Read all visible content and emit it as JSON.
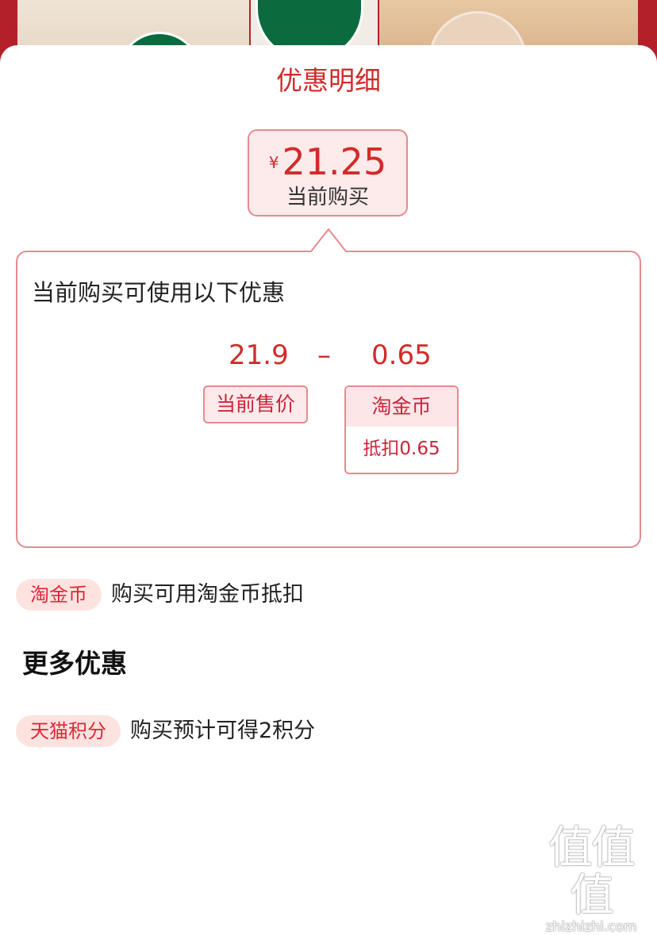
{
  "sheet": {
    "title": "优惠明细",
    "current_price": {
      "currency": "¥",
      "amount": "21.25",
      "label": "当前购买"
    },
    "detail": {
      "heading": "当前购买可使用以下优惠",
      "base_price": "21.9",
      "operator": "–",
      "discount_amount": "0.65",
      "base_price_tag": "当前售价",
      "discount_tag_title": "淘金币",
      "discount_tag_value": "抵扣0.65"
    },
    "coin_row": {
      "badge": "淘金币",
      "text": "购买可用淘金币抵扣"
    },
    "more_title": "更多优惠",
    "points_row": {
      "badge": "天猫积分",
      "text": "购买预计可得2积分"
    }
  },
  "watermark": {
    "mark": "值值值",
    "url": "zhizhizhi.com"
  },
  "colors": {
    "accent": "#d12b2b",
    "tag_border": "#e88a8f",
    "tag_fill": "#fdeaea",
    "pill_fill": "#fde3df"
  }
}
